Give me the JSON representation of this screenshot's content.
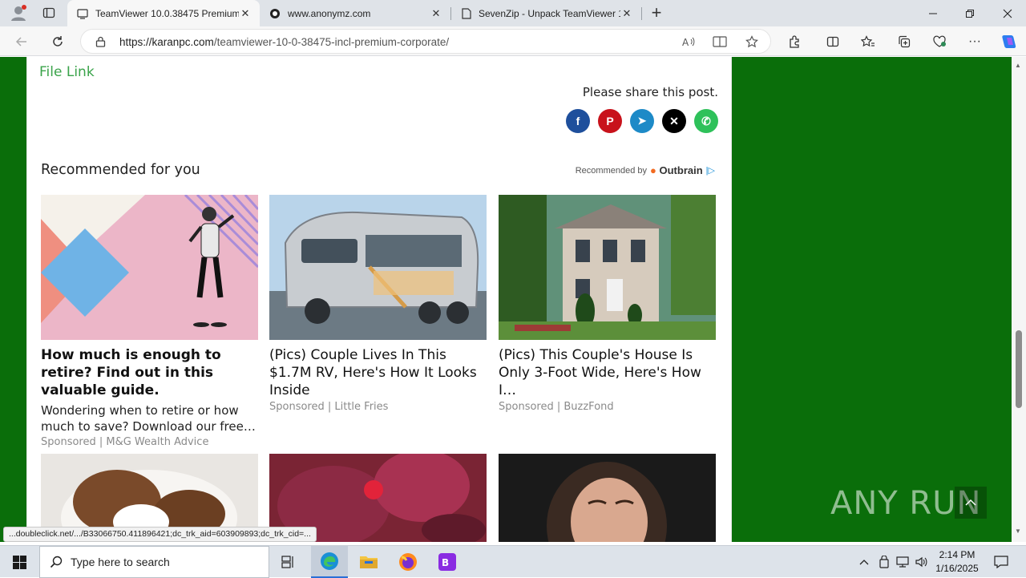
{
  "browser": {
    "tabs": [
      {
        "title": "TeamViewer 10.0.38475 Premium",
        "icon": "page-icon",
        "active": true
      },
      {
        "title": "www.anonymz.com",
        "icon": "anonymz-icon",
        "active": false
      },
      {
        "title": "SevenZip - Unpack TeamViewer 1",
        "icon": "document-icon",
        "active": false
      }
    ],
    "new_tab_label": "+",
    "url_host": "https://karanpc.com",
    "url_path": "/teamviewer-10-0-38475-incl-premium-corporate/"
  },
  "page": {
    "file_link_label": "File Link",
    "share_prompt": "Please share this post.",
    "share_buttons": [
      {
        "name": "facebook",
        "glyph": "f",
        "color": "#1e4f9c"
      },
      {
        "name": "pinterest",
        "glyph": "P",
        "color": "#c8121b"
      },
      {
        "name": "telegram",
        "glyph": "➤",
        "color": "#1d8ac7"
      },
      {
        "name": "x",
        "glyph": "✕",
        "color": "#000000"
      },
      {
        "name": "whatsapp",
        "glyph": "✆",
        "color": "#2ec15a"
      }
    ],
    "recommended_title": "Recommended for you",
    "recommended_by": "Recommended by",
    "outbrain_label": "Outbrain",
    "cards": [
      {
        "headline": "How much is enough to retire? Find out in this valuable guide.",
        "description": "Wondering when to retire or how much to save? Download our free …",
        "sponsor": "Sponsored | M&G Wealth Advice"
      },
      {
        "headline": "(Pics) Couple Lives In This $1.7M RV, Here's How It Looks Inside",
        "sponsor": "Sponsored | Little Fries"
      },
      {
        "headline": "(Pics) This Couple's House Is Only 3-Foot Wide, Here's How I…",
        "sponsor": "Sponsored | BuzzFond"
      }
    ],
    "status_link": "...doubleclick.net/.../B33066750.411896421;dc_trk_aid=603909893;dc_trk_cid=...",
    "watermark": "ANY RUN"
  },
  "taskbar": {
    "search_placeholder": "Type here to search",
    "time": "2:14 PM",
    "date": "1/16/2025"
  }
}
